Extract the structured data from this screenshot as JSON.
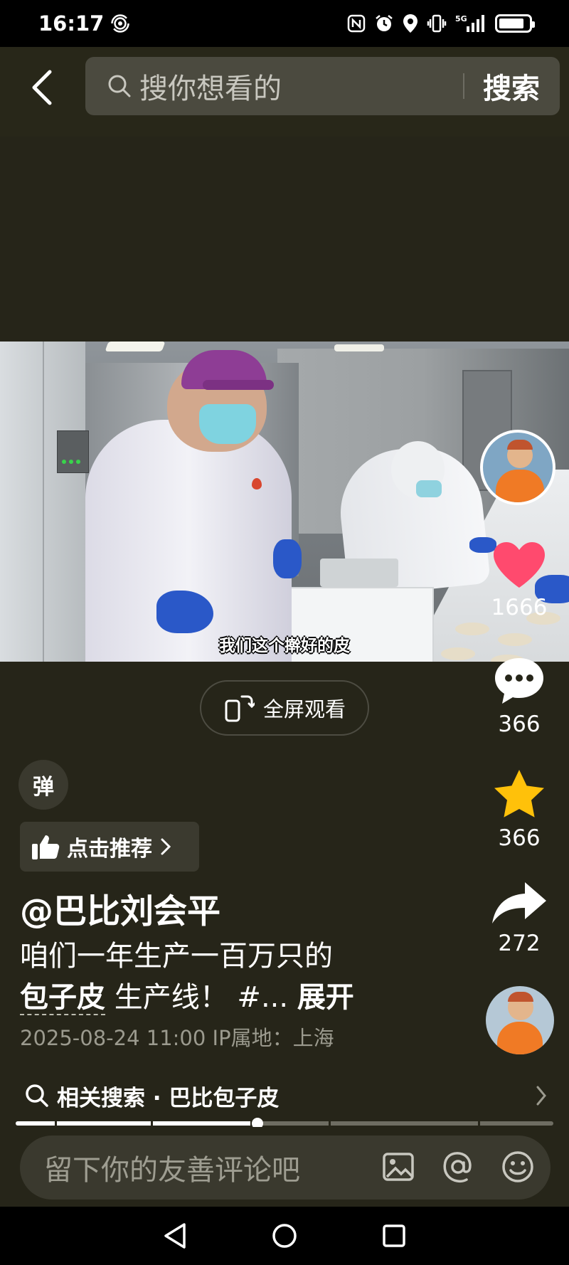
{
  "status_bar": {
    "time": "16:17",
    "network": "5G",
    "battery_level": 0.85
  },
  "header": {
    "search_placeholder": "搜你想看的",
    "search_button": "搜索"
  },
  "video": {
    "subtitle": "我们这个擀好的皮",
    "fullscreen_label": "全屏观看",
    "progress": 0.45
  },
  "actions": {
    "likes": "1666",
    "comments": "366",
    "favorites": "366",
    "shares": "272"
  },
  "post": {
    "danmu_label": "弹",
    "recommend_label": "点击推荐",
    "author": "@巴比刘会平",
    "desc_line1": "咱们一年生产一百万只的",
    "desc_keyword": "包子皮",
    "desc_line2_rest": "生产线！ #...",
    "desc_more": "展开",
    "meta": "2025-08-24 11:00  IP属地：上海"
  },
  "related_search": {
    "label": "相关搜索 · 巴比包子皮"
  },
  "comment": {
    "placeholder": "留下你的友善评论吧"
  },
  "colors": {
    "background": "#262519",
    "like_red": "#ff4a6e",
    "star_yellow": "#ffc10a"
  },
  "icons": [
    "back-icon",
    "search-icon",
    "fullscreen-icon",
    "heart-icon",
    "comment-icon",
    "star-icon",
    "share-icon",
    "thumbs-up-icon",
    "chevron-right-icon",
    "image-icon",
    "at-icon",
    "emoji-icon"
  ]
}
